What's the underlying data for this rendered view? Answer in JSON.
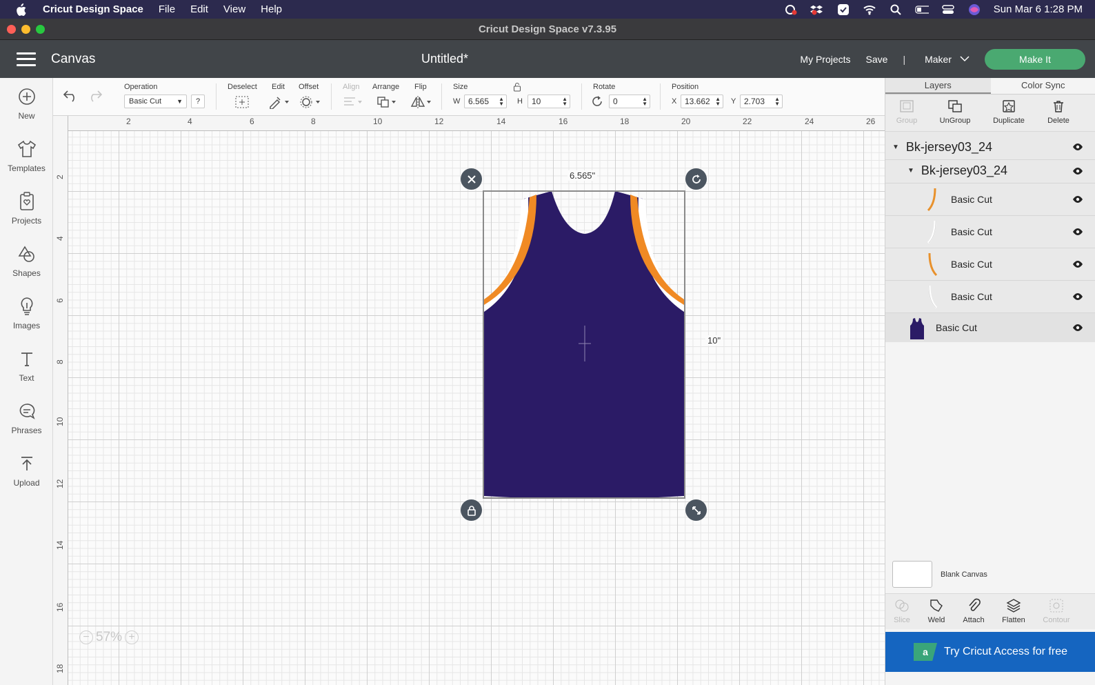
{
  "menubar": {
    "app_name": "Cricut Design Space",
    "menus": [
      "File",
      "Edit",
      "View",
      "Help"
    ],
    "clock": "Sun Mar 6  1:28 PM"
  },
  "window": {
    "title": "Cricut Design Space  v7.3.95"
  },
  "header": {
    "canvas_label": "Canvas",
    "doc_title": "Untitled*",
    "my_projects": "My Projects",
    "save": "Save",
    "separator": "|",
    "machine": "Maker",
    "make_it": "Make It"
  },
  "sidebar": {
    "items": [
      {
        "label": "New",
        "icon": "plus-circle-icon"
      },
      {
        "label": "Templates",
        "icon": "shirt-icon"
      },
      {
        "label": "Projects",
        "icon": "clipboard-heart-icon"
      },
      {
        "label": "Shapes",
        "icon": "shapes-icon"
      },
      {
        "label": "Images",
        "icon": "lightbulb-icon"
      },
      {
        "label": "Text",
        "icon": "text-t-icon"
      },
      {
        "label": "Phrases",
        "icon": "speech-bubble-icon"
      },
      {
        "label": "Upload",
        "icon": "upload-icon"
      }
    ]
  },
  "toolbar": {
    "operation_label": "Operation",
    "operation_value": "Basic Cut",
    "help": "?",
    "deselect": "Deselect",
    "edit": "Edit",
    "offset": "Offset",
    "align": "Align",
    "arrange": "Arrange",
    "flip": "Flip",
    "size_label": "Size",
    "w_label": "W",
    "w_value": "6.565",
    "h_label": "H",
    "h_value": "10",
    "rotate_label": "Rotate",
    "rotate_value": "0",
    "position_label": "Position",
    "x_label": "X",
    "x_value": "13.662",
    "y_label": "Y",
    "y_value": "2.703"
  },
  "canvas": {
    "ruler_top": [
      "2",
      "4",
      "6",
      "8",
      "10",
      "12",
      "14",
      "16",
      "18",
      "20",
      "22",
      "24",
      "26"
    ],
    "ruler_left": [
      "2",
      "4",
      "6",
      "8",
      "10",
      "12",
      "14",
      "16",
      "18"
    ],
    "width_label": "6.565\"",
    "height_label": "10\"",
    "zoom": "57%",
    "jersey_colors": {
      "body": "#2b1b66",
      "stripe": "#f08a24",
      "trim": "#ffffff"
    }
  },
  "right_panel": {
    "tabs": [
      "Layers",
      "Color Sync"
    ],
    "tools": [
      {
        "label": "Group",
        "enabled": false
      },
      {
        "label": "UnGroup",
        "enabled": true
      },
      {
        "label": "Duplicate",
        "enabled": true
      },
      {
        "label": "Delete",
        "enabled": true
      }
    ],
    "layers": {
      "group": "Bk-jersey03_24",
      "subgroup": "Bk-jersey03_24",
      "children": [
        "Basic Cut",
        "Basic Cut",
        "Basic Cut",
        "Basic Cut"
      ],
      "base": "Basic Cut"
    },
    "blank_canvas": "Blank Canvas",
    "bottom_tools": [
      {
        "label": "Slice",
        "enabled": false
      },
      {
        "label": "Weld",
        "enabled": true
      },
      {
        "label": "Attach",
        "enabled": true
      },
      {
        "label": "Flatten",
        "enabled": true
      },
      {
        "label": "Contour",
        "enabled": false
      }
    ],
    "access_banner": "Try Cricut Access for free"
  }
}
